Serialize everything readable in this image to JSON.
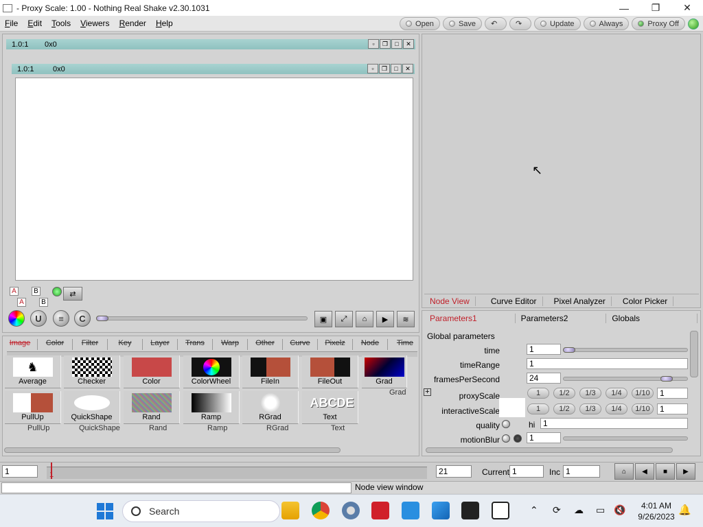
{
  "window": {
    "title": "- Proxy Scale: 1.00 - Nothing Real Shake v2.30.1031",
    "controls": [
      "—",
      "❐",
      "✕"
    ]
  },
  "menu": [
    "File",
    "Edit",
    "Tools",
    "Viewers",
    "Render",
    "Help"
  ],
  "toolbar": {
    "open": "Open",
    "save": "Save",
    "update": "Update",
    "always": "Always",
    "proxy": "Proxy Off"
  },
  "viewer": {
    "outer_zoom": "1.0:1",
    "outer_coords": "0x0",
    "inner_zoom": "1.0:1",
    "inner_coords": "0x0",
    "ab_a": "A",
    "ab_b": "B"
  },
  "node_tabs": [
    "Image",
    "Color",
    "Filter",
    "Key",
    "Layer",
    "Trans",
    "Warp",
    "Other",
    "Curve",
    "Pixelz",
    "Node",
    "Time"
  ],
  "nodes_row1": [
    "Average",
    "Checker",
    "Color",
    "ColorWheel",
    "FileIn",
    "FileOut",
    "Grad"
  ],
  "nodes_row2": [
    "PullUp",
    "QuickShape",
    "Rand",
    "Ramp",
    "RGrad",
    "Text"
  ],
  "nodes_bg_row2": [
    "PullUp",
    "QuickShape",
    "Rand",
    "Ramp",
    "RGrad",
    "Text"
  ],
  "nodes_bg_grad": "Grad",
  "text_node_preview": "ABCDE",
  "view_tabs": [
    "Node View",
    "Curve Editor",
    "Pixel Analyzer",
    "Color Picker"
  ],
  "param_tabs": [
    "Parameters1",
    "Parameters2",
    "Globals"
  ],
  "params": {
    "section": "Global parameters",
    "time_label": "time",
    "time_value": "1",
    "timeRange_label": "timeRange",
    "timeRange_value": "1",
    "fps_label": "framesPerSecond",
    "fps_value": "24",
    "proxyScale_label": "proxyScale",
    "proxyScale_value": "1",
    "interactiveScale_label": "interactiveScale",
    "interactiveScale_value": "1",
    "scale_options": [
      "1",
      "1/2",
      "1/3",
      "1/4",
      "1/10"
    ],
    "quality_label": "quality",
    "quality_prefix": "hi",
    "quality_value": "1",
    "motionBlur_label": "motionBlur",
    "motionBlur_value": "1",
    "expand_symbol": "+"
  },
  "timebar": {
    "start": "1",
    "marker": "1",
    "end": "21",
    "current_label": "Current",
    "current_value": "1",
    "inc_label": "Inc",
    "inc_value": "1"
  },
  "status": "Node view window",
  "taskbar": {
    "search": "Search",
    "time": "4:01 AM",
    "date": "9/26/2023"
  },
  "colors": {
    "accent_red": "#c0202a",
    "viewer_bar": "#9cc9c7",
    "win_blue": "#1f79d6"
  }
}
